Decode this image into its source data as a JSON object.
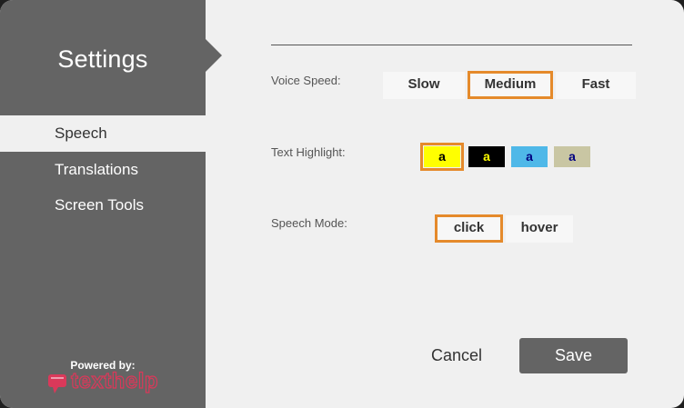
{
  "sidebar": {
    "title": "Settings",
    "items": [
      {
        "label": "Speech",
        "active": true
      },
      {
        "label": "Translations",
        "active": false
      },
      {
        "label": "Screen Tools",
        "active": false
      }
    ],
    "powered_by": "Powered by:",
    "brand": "texthelp",
    "brand_icon": "texthelp-logo-icon"
  },
  "voice_speed": {
    "label": "Voice Speed:",
    "options": [
      "Slow",
      "Medium",
      "Fast"
    ],
    "selected": "Medium"
  },
  "text_highlight": {
    "label": "Text Highlight:",
    "swatch_text": "a",
    "swatches": [
      {
        "bg": "#ffff00",
        "fg": "#000000",
        "selected": true
      },
      {
        "bg": "#000000",
        "fg": "#ffff00",
        "selected": false
      },
      {
        "bg": "#4fb8e8",
        "fg": "#000080",
        "selected": false
      },
      {
        "bg": "#c9c6a3",
        "fg": "#000080",
        "selected": false
      }
    ]
  },
  "speech_mode": {
    "label": "Speech Mode:",
    "options": [
      "click",
      "hover"
    ],
    "selected": "click"
  },
  "footer": {
    "cancel_label": "Cancel",
    "save_label": "Save"
  },
  "colors": {
    "sidebar_bg": "#646464",
    "panel_bg": "#f0f0f0",
    "accent": "#e58a2b"
  }
}
